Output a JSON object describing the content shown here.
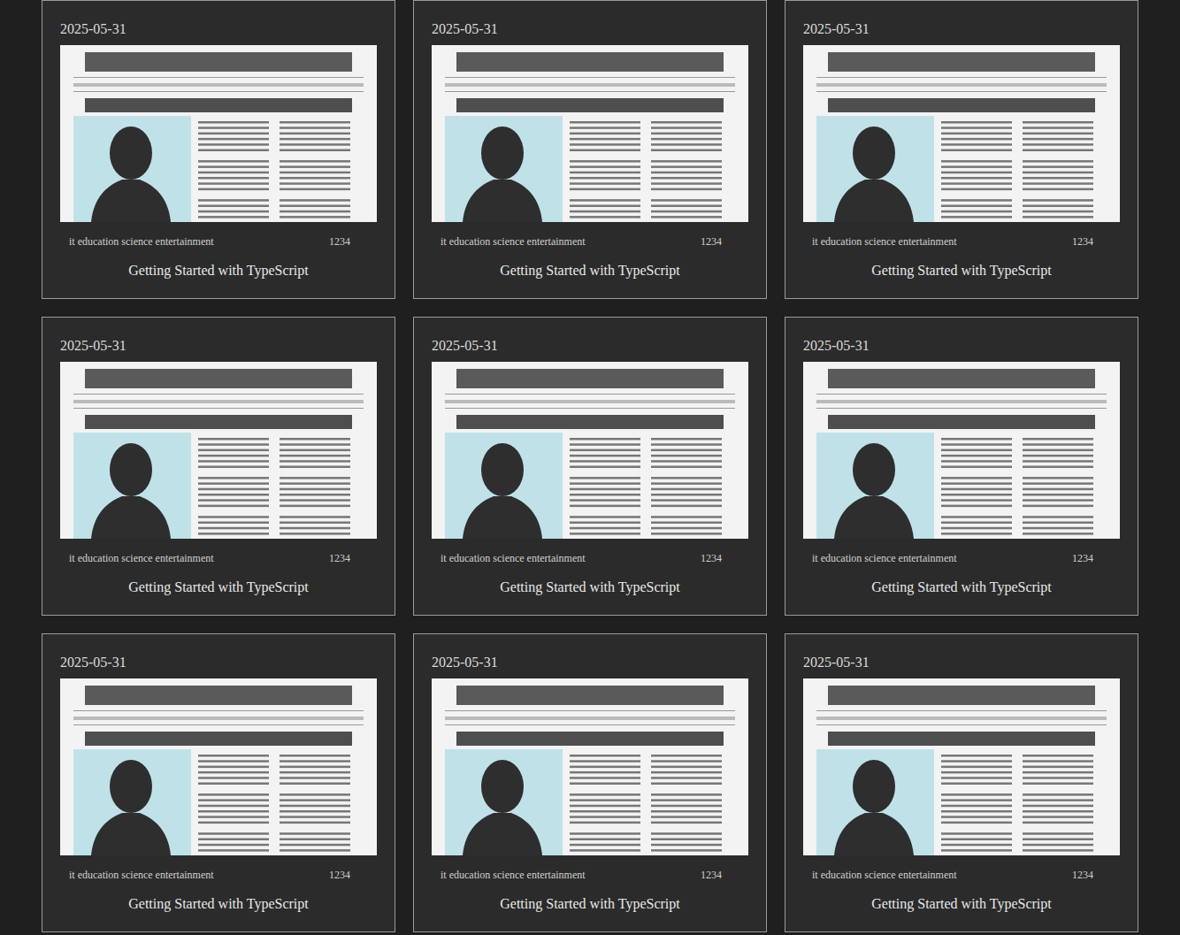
{
  "cards": [
    {
      "date": "2025-05-31",
      "tags": "it education science entertainment",
      "count": "1234",
      "title": "Getting Started with TypeScript"
    },
    {
      "date": "2025-05-31",
      "tags": "it education science entertainment",
      "count": "1234",
      "title": "Getting Started with TypeScript"
    },
    {
      "date": "2025-05-31",
      "tags": "it education science entertainment",
      "count": "1234",
      "title": "Getting Started with TypeScript"
    },
    {
      "date": "2025-05-31",
      "tags": "it education science entertainment",
      "count": "1234",
      "title": "Getting Started with TypeScript"
    },
    {
      "date": "2025-05-31",
      "tags": "it education science entertainment",
      "count": "1234",
      "title": "Getting Started with TypeScript"
    },
    {
      "date": "2025-05-31",
      "tags": "it education science entertainment",
      "count": "1234",
      "title": "Getting Started with TypeScript"
    },
    {
      "date": "2025-05-31",
      "tags": "it education science entertainment",
      "count": "1234",
      "title": "Getting Started with TypeScript"
    },
    {
      "date": "2025-05-31",
      "tags": "it education science entertainment",
      "count": "1234",
      "title": "Getting Started with TypeScript"
    },
    {
      "date": "2025-05-31",
      "tags": "it education science entertainment",
      "count": "1234",
      "title": "Getting Started with TypeScript"
    }
  ]
}
